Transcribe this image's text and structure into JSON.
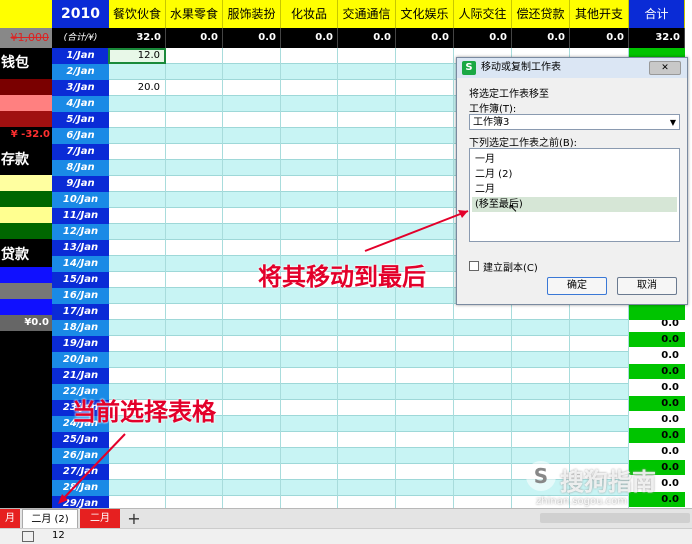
{
  "colors": {
    "accent_yellow": "#ffff00",
    "date_blue": "#0a2bd6",
    "total_green": "#00c400",
    "dialog_bg": "#f0f0f0"
  },
  "header": {
    "year": "2010",
    "categories": [
      "餐饮伙食",
      "水果零食",
      "服饰装扮",
      "化妆品",
      "交通通信",
      "文化娱乐",
      "人际交往",
      "偿还贷款",
      "其他开支",
      "合计"
    ],
    "sum_label": "(合计/¥)",
    "sums": [
      "32.0",
      "0.0",
      "0.0",
      "0.0",
      "0.0",
      "0.0",
      "0.0",
      "0.0",
      "0.0",
      "32.0"
    ]
  },
  "left_panel": {
    "amount_top": "¥1,000",
    "wallet_label": "钱包",
    "amount_mid": "¥ -32.0",
    "deposit_label": "存款",
    "loan_label": "贷款",
    "amount_bottom": "¥0.0"
  },
  "dates": [
    "1/Jan",
    "2/Jan",
    "3/Jan",
    "4/Jan",
    "5/Jan",
    "6/Jan",
    "7/Jan",
    "8/Jan",
    "9/Jan",
    "10/Jan",
    "11/Jan",
    "12/Jan",
    "13/Jan",
    "14/Jan",
    "15/Jan",
    "16/Jan",
    "17/Jan",
    "18/Jan",
    "19/Jan",
    "20/Jan",
    "21/Jan",
    "22/Jan",
    "23/Jan",
    "24/Jan",
    "25/Jan",
    "26/Jan",
    "27/Jan",
    "28/Jan",
    "29/Jan"
  ],
  "cell_values": {
    "food_row1": "12.0",
    "food_row3": "20.0"
  },
  "totals": [
    "0.0",
    "0.0",
    "0.0",
    "0.0",
    "0.0",
    "0.0",
    "0.0",
    "0.0",
    "0.0",
    "0.0",
    "0.0",
    "0.0"
  ],
  "dialog": {
    "app_icon": "S",
    "title": "移动或复制工作表",
    "close_icon": "✕",
    "move_label": "将选定工作表移至",
    "workbook_label": "工作簿(T):",
    "workbook_value": "工作簿3",
    "before_label": "下列选定工作表之前(B):",
    "sheets": [
      "一月",
      "二月 (2)",
      "二月",
      "(移至最后)"
    ],
    "copy_label": "建立副本(C)",
    "ok": "确定",
    "cancel": "取消"
  },
  "annotations": {
    "move_to_last": "将其移动到最后",
    "current_sheet": "当前选择表格"
  },
  "tabs": {
    "items": [
      "月",
      "二月 (2)",
      "二月"
    ],
    "add": "+"
  },
  "status": {
    "value": "12"
  },
  "watermark": {
    "text": "搜狗指南",
    "url": "zhinan.sogou.com"
  }
}
